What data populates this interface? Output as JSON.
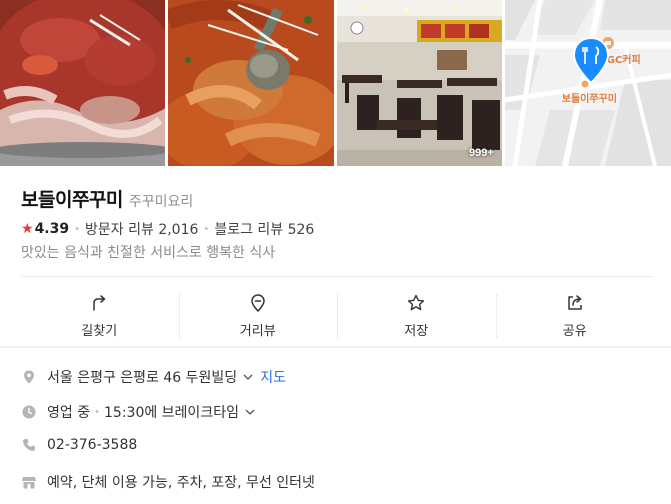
{
  "photos": {
    "count_badge": "999+"
  },
  "map_tile": {
    "cafe_label": "GC커피",
    "place_label": "보들이쭈꾸미",
    "pin_color": "#1a8cff",
    "label_color": "#e07a3c"
  },
  "place": {
    "name": "보들이쭈꾸미",
    "category": "주꾸미요리",
    "rating": "4.39",
    "visitor_reviews": "방문자 리뷰 2,016",
    "blog_reviews": "블로그 리뷰 526",
    "description": "맛있는 음식과 친절한 서비스로 행복한 식사"
  },
  "actions": [
    {
      "label": "길찾기",
      "icon": "directions-icon"
    },
    {
      "label": "거리뷰",
      "icon": "street-view-icon"
    },
    {
      "label": "저장",
      "icon": "star-outline-icon"
    },
    {
      "label": "공유",
      "icon": "share-icon"
    }
  ],
  "details": {
    "address": "서울 은평구 은평로 46 두원빌딩",
    "map_link": "지도",
    "status": "영업 중",
    "hours_note": "15:30에 브레이크타임",
    "phone": "02-376-3588",
    "amenities": "예약, 단체 이용 가능, 주차, 포장, 무선 인터넷"
  },
  "colors": {
    "accent_blue": "#2d6fdf",
    "star_red": "#e83b36"
  }
}
